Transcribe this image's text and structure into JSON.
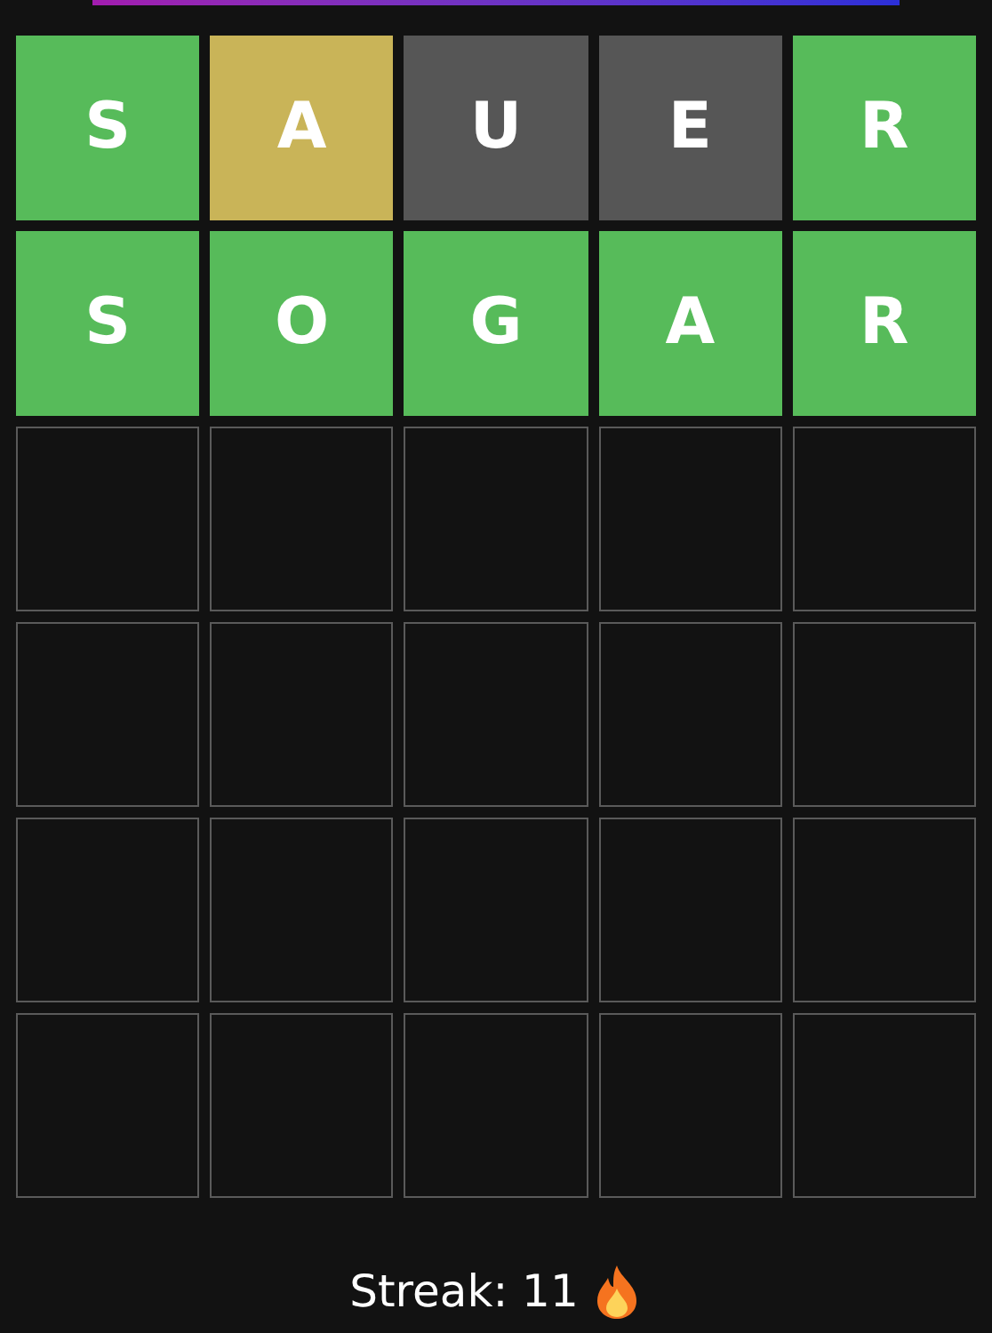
{
  "rows": [
    {
      "tiles": [
        {
          "letter": "S",
          "kind": "correct"
        },
        {
          "letter": "A",
          "kind": "present"
        },
        {
          "letter": "U",
          "kind": "absent"
        },
        {
          "letter": "E",
          "kind": "absent"
        },
        {
          "letter": "R",
          "kind": "correct"
        }
      ]
    },
    {
      "tiles": [
        {
          "letter": "S",
          "kind": "correct"
        },
        {
          "letter": "O",
          "kind": "correct"
        },
        {
          "letter": "G",
          "kind": "correct"
        },
        {
          "letter": "A",
          "kind": "correct"
        },
        {
          "letter": "R",
          "kind": "correct"
        }
      ]
    },
    {
      "tiles": [
        {
          "kind": "empty"
        },
        {
          "kind": "empty"
        },
        {
          "kind": "empty"
        },
        {
          "kind": "empty"
        },
        {
          "kind": "empty"
        }
      ]
    },
    {
      "tiles": [
        {
          "kind": "empty"
        },
        {
          "kind": "empty"
        },
        {
          "kind": "empty"
        },
        {
          "kind": "empty"
        },
        {
          "kind": "empty"
        }
      ]
    },
    {
      "tiles": [
        {
          "kind": "empty"
        },
        {
          "kind": "empty"
        },
        {
          "kind": "empty"
        },
        {
          "kind": "empty"
        },
        {
          "kind": "empty"
        }
      ]
    },
    {
      "tiles": [
        {
          "kind": "empty"
        },
        {
          "kind": "empty"
        },
        {
          "kind": "empty"
        },
        {
          "kind": "empty"
        },
        {
          "kind": "empty"
        }
      ]
    }
  ],
  "streak": "Streak: 11"
}
